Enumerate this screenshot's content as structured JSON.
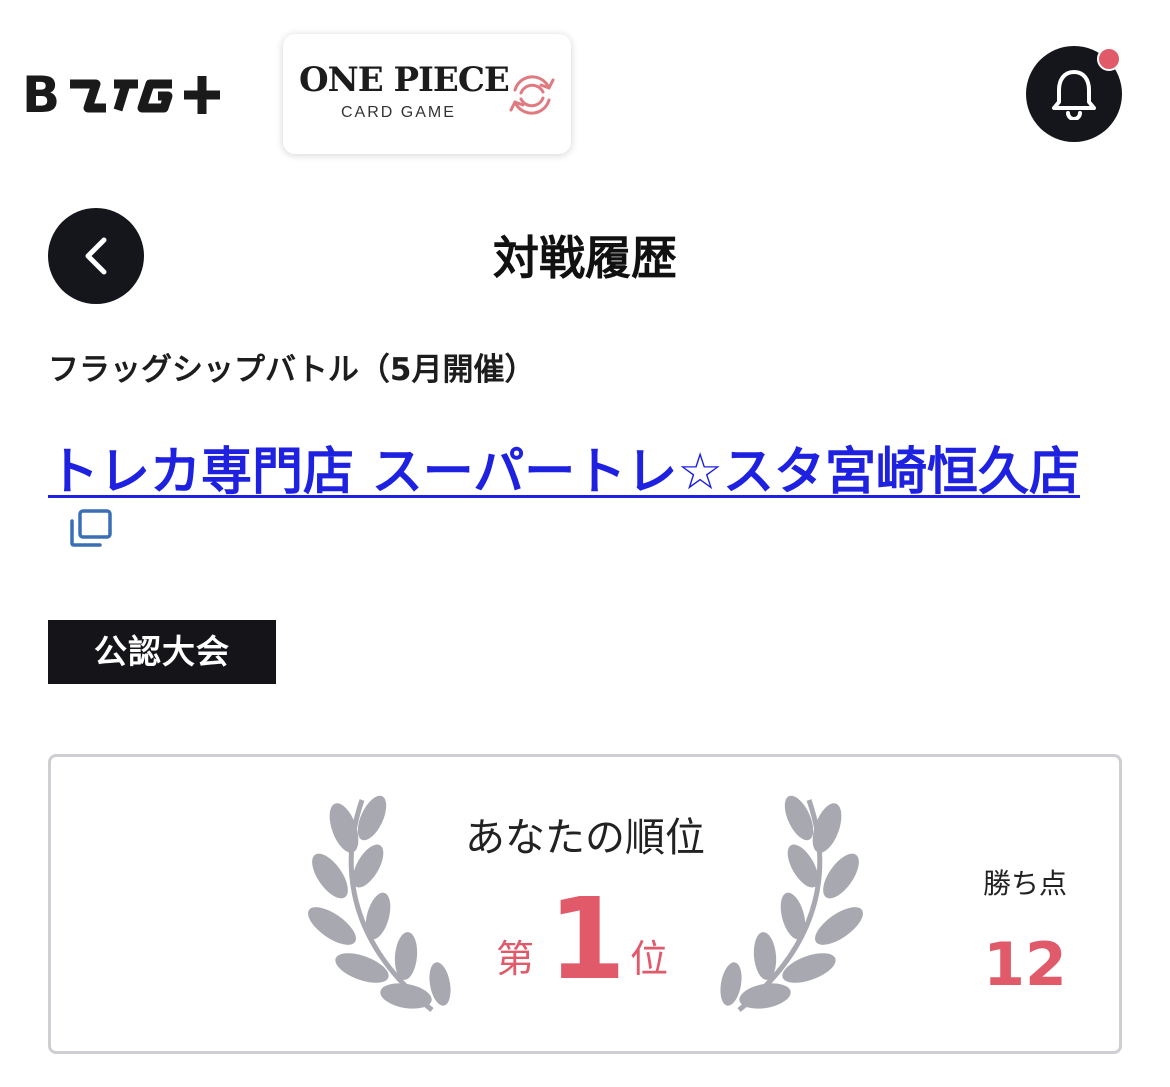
{
  "header": {
    "brand_logo_text": "B TCG+",
    "game_logo": {
      "title": "ONE PIECE",
      "subtitle": "CARD GAME",
      "icon": "sync-icon"
    },
    "notification_icon": "bell-icon",
    "notification_badge_color": "#e05a6a"
  },
  "page": {
    "back_icon": "chevron-left-icon",
    "title": "対戦履歴"
  },
  "event": {
    "name": "フラッグシップバトル（5月開催）",
    "store_name": "トレカ専門店 スーパートレ☆スタ宮崎恒久店",
    "store_link_icon": "external-window-icon",
    "tag": "公認大会"
  },
  "result": {
    "rank_label": "あなたの順位",
    "rank_prefix": "第",
    "rank": "1",
    "rank_suffix": "位",
    "points_label": "勝ち点",
    "points": "12"
  },
  "colors": {
    "accent": "#e05a6a",
    "dark": "#15161b",
    "link": "#1f21e0",
    "card_border": "#cfcfd3",
    "laurel": "#a8a8b0"
  }
}
